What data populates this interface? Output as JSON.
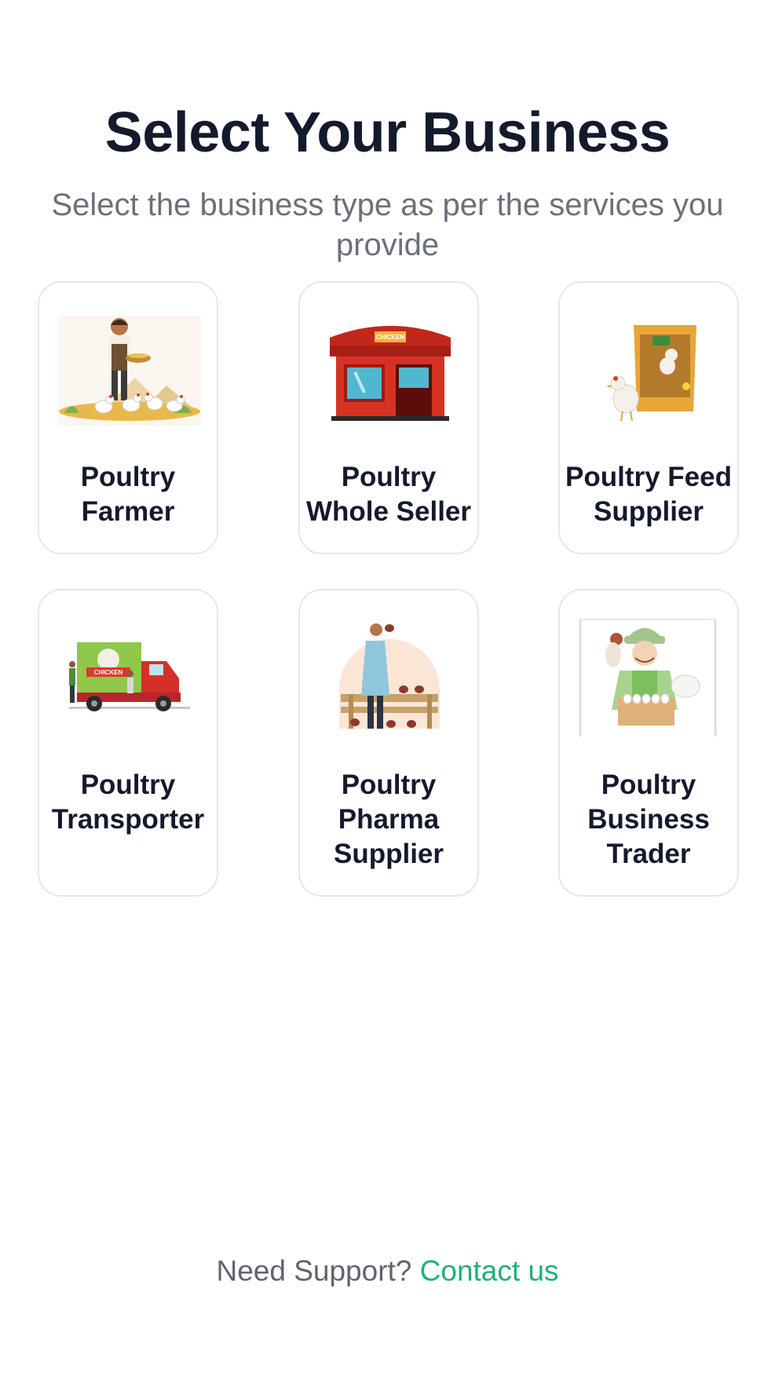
{
  "header": {
    "title": "Select Your Business",
    "subtitle": "Select the business type as per the services you provide"
  },
  "business_types": [
    {
      "label": "Poultry Farmer",
      "icon": "poultry-farmer-illustration"
    },
    {
      "label": "Poultry Whole Seller",
      "icon": "chicken-shop-illustration",
      "shop_sign": "CHICKEN"
    },
    {
      "label": "Poultry Feed Supplier",
      "icon": "feed-bag-illustration"
    },
    {
      "label": "Poultry Transporter",
      "icon": "chicken-truck-illustration",
      "truck_sign": "CHICKEN"
    },
    {
      "label": "Poultry Pharma Supplier",
      "icon": "vet-pharma-illustration"
    },
    {
      "label": "Poultry Business Trader",
      "icon": "egg-trader-illustration"
    }
  ],
  "footer": {
    "support_text": "Need Support?",
    "contact_link": "Contact us"
  },
  "colors": {
    "title": "#131a2b",
    "subtitle": "#6b707a",
    "card_border": "#e5e7eb",
    "link": "#1fb07a"
  }
}
